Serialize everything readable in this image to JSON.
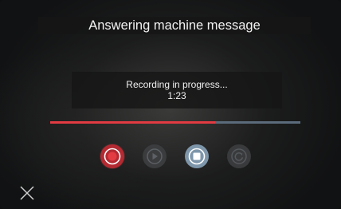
{
  "title": "Answering machine message",
  "status": {
    "line1": "Recording in progress...",
    "line2": "1:23"
  },
  "progress": {
    "fraction": 0.66,
    "fill_color": "#e23b42",
    "track_color": "#5b6b7c"
  },
  "controls": [
    {
      "icon": "record-icon",
      "state": "active",
      "color": "#e23b42"
    },
    {
      "icon": "play-icon",
      "state": "disabled"
    },
    {
      "icon": "stop-icon",
      "state": "enabled"
    },
    {
      "icon": "replay-icon",
      "state": "disabled"
    }
  ],
  "close_icon": "close-icon"
}
